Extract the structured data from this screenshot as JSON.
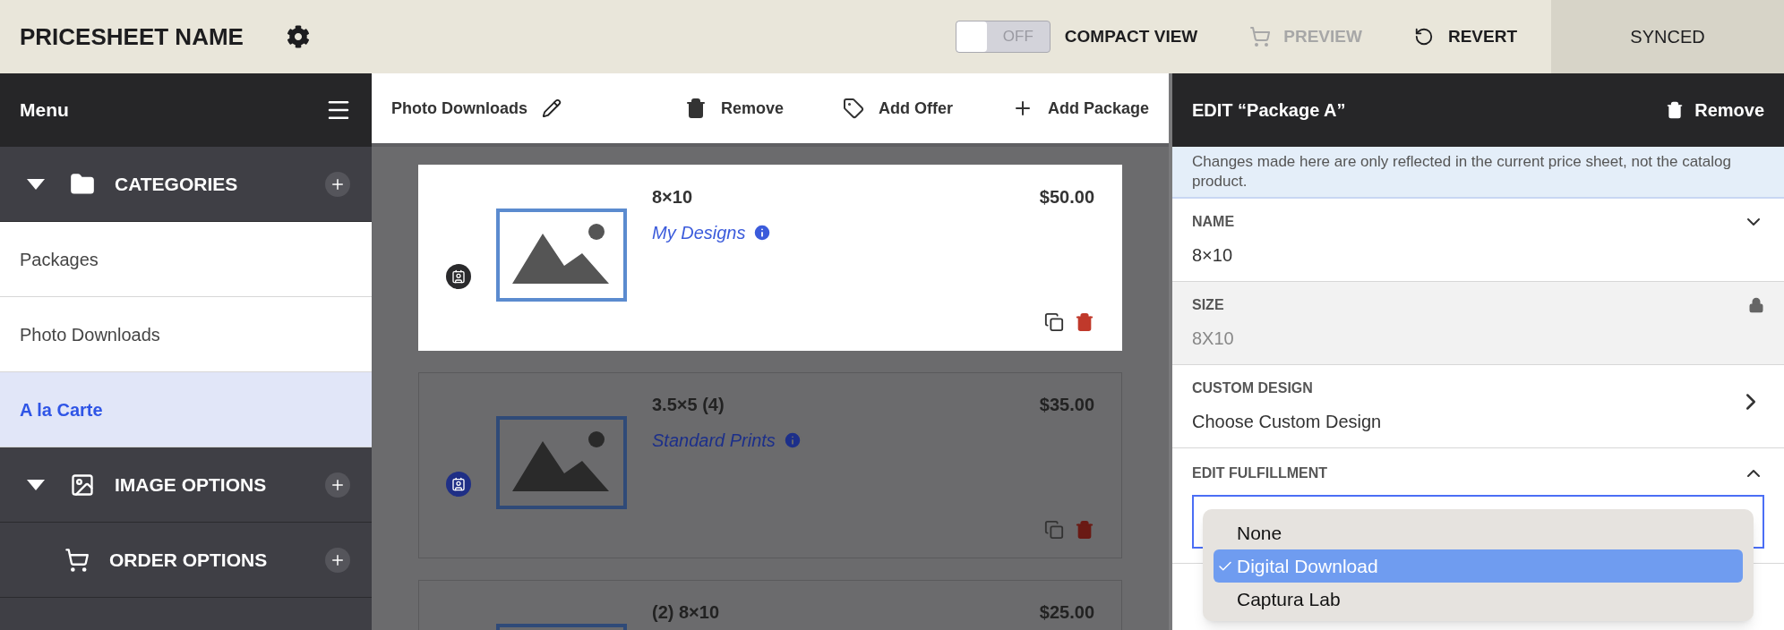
{
  "header": {
    "title": "PRICESHEET NAME",
    "compact_toggle": {
      "label": "OFF",
      "on": false
    },
    "compact_label": "COMPACT VIEW",
    "preview": {
      "label": "PREVIEW",
      "disabled": true
    },
    "revert": "REVERT",
    "status": "SYNCED"
  },
  "sidebar": {
    "title": "Menu",
    "sections": [
      {
        "label": "CATEGORIES",
        "kind": "collapsible",
        "expanded": true,
        "items": [
          {
            "label": "Packages",
            "selected": false
          },
          {
            "label": "Photo Downloads",
            "selected": false
          },
          {
            "label": "A la Carte",
            "selected": true
          }
        ]
      },
      {
        "label": "IMAGE OPTIONS",
        "kind": "collapsible",
        "expanded": true
      },
      {
        "label": "ORDER OPTIONS",
        "kind": "plain"
      }
    ]
  },
  "toolbar": {
    "title": "Photo Downloads",
    "actions": [
      "Remove",
      "Add Offer",
      "Add Package"
    ]
  },
  "products": [
    {
      "name": "8×10",
      "price": "$50.00",
      "design": "My Designs",
      "selected": true
    },
    {
      "name": "3.5×5 (4)",
      "price": "$35.00",
      "design": "Standard Prints",
      "selected": false
    },
    {
      "name": "(2) 8×10",
      "price": "$25.00",
      "selected": false
    }
  ],
  "editor": {
    "title": "EDIT “Package A”",
    "remove": "Remove",
    "notice": "Changes made here are only reflected in the current price sheet, not the catalog product.",
    "fields": [
      {
        "kind": "text",
        "label": "NAME",
        "value": "8×10",
        "expanded": false
      },
      {
        "kind": "locked",
        "label": "SIZE",
        "value": "8X10"
      },
      {
        "kind": "link",
        "label": "CUSTOM DESIGN",
        "value": "Choose Custom Design"
      },
      {
        "kind": "select",
        "label": "EDIT FULFILLMENT",
        "expanded": true,
        "options": [
          {
            "label": "None",
            "selected": false
          },
          {
            "label": "Digital Download",
            "selected": true
          },
          {
            "label": "Captura Lab",
            "selected": false
          }
        ]
      }
    ]
  }
}
